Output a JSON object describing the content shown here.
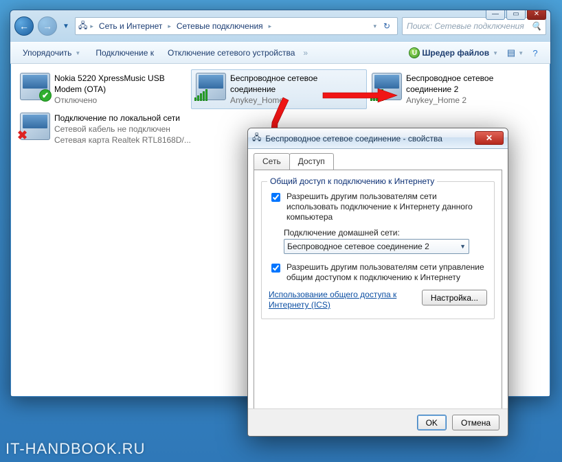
{
  "breadcrumb": {
    "a": "Сеть и Интернет",
    "b": "Сетевые подключения"
  },
  "search": {
    "placeholder": "Поиск: Сетевые подключения"
  },
  "toolbar": {
    "organize": "Упорядочить",
    "connect": "Подключение к",
    "disable": "Отключение сетевого устройства",
    "shredder": "Шредер файлов"
  },
  "connections": [
    {
      "title": "Nokia 5220 XpressMusic USB Modem (OTA)",
      "sub1": "Отключено",
      "sub2": ""
    },
    {
      "title": "Беспроводное сетевое соединение",
      "sub1": "Anykey_Home",
      "sub2": ""
    },
    {
      "title": "Беспроводное сетевое соединение 2",
      "sub1": "Anykey_Home 2",
      "sub2": ""
    },
    {
      "title": "Подключение по локальной сети",
      "sub1": "Сетевой кабель не подключен",
      "sub2": "Сетевая карта Realtek RTL8168D/..."
    }
  ],
  "dialog": {
    "title": "Беспроводное сетевое соединение - свойства",
    "tab_network": "Сеть",
    "tab_sharing": "Доступ",
    "group_legend": "Общий доступ к подключению к Интернету",
    "allow_share": "Разрешить другим пользователям сети использовать подключение к Интернету данного компьютера",
    "home_net_label": "Подключение домашней сети:",
    "home_net_value": "Беспроводное сетевое соединение 2",
    "allow_ctrl": "Разрешить другим пользователям сети управление общим доступом к подключению к Интернету",
    "link": "Использование общего доступа к Интернету (ICS)",
    "settings_btn": "Настройка...",
    "ok": "OK",
    "cancel": "Отмена"
  },
  "watermark": "IT-HANDBOOK.RU"
}
